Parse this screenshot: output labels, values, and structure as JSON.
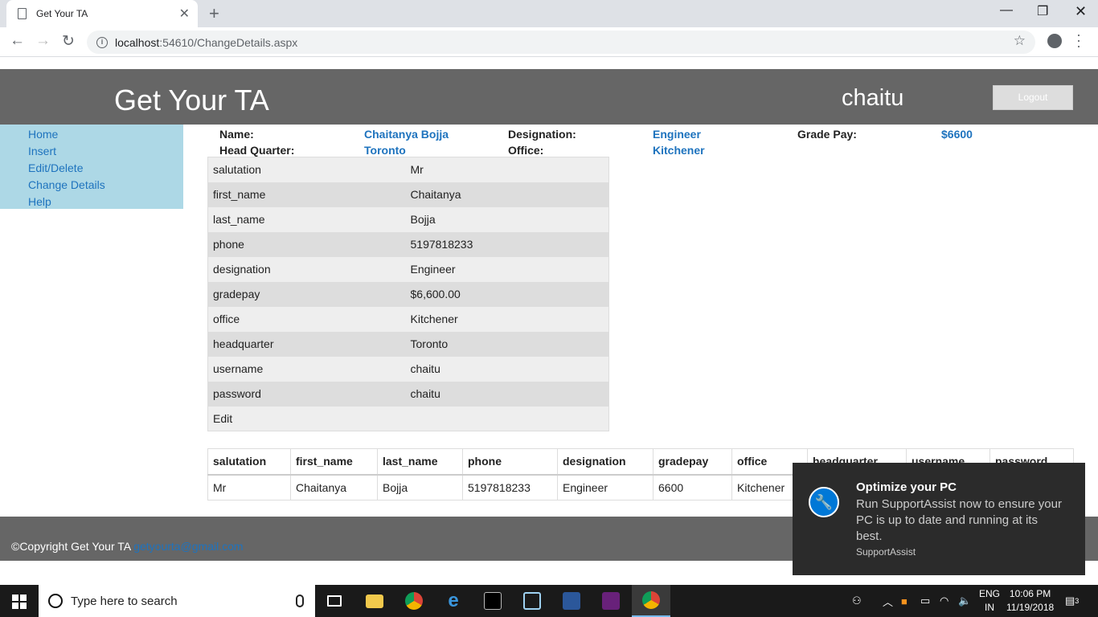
{
  "browser": {
    "tab_title": "Get Your TA",
    "url_host": "localhost",
    "url_path": ":54610/ChangeDetails.aspx"
  },
  "header": {
    "app_title": "Get Your TA",
    "user": "chaitu",
    "logout_label": "Logout"
  },
  "sidebar": {
    "items": [
      {
        "label": "Home"
      },
      {
        "label": "Insert"
      },
      {
        "label": "Edit/Delete"
      },
      {
        "label": "Change Details"
      },
      {
        "label": "Help"
      }
    ]
  },
  "summary": {
    "name_label": "Name:",
    "name_value": "Chaitanya Bojja",
    "designation_label": "Designation:",
    "designation_value": "Engineer",
    "gradepay_label": "Grade Pay:",
    "gradepay_value": "$6600",
    "hq_label": "Head Quarter:",
    "hq_value": "Toronto",
    "office_label": "Office:",
    "office_value": "Kitchener"
  },
  "details": {
    "rows": [
      {
        "key": "salutation",
        "value": "Mr"
      },
      {
        "key": "first_name",
        "value": "Chaitanya"
      },
      {
        "key": "last_name",
        "value": "Bojja"
      },
      {
        "key": "phone",
        "value": "5197818233"
      },
      {
        "key": "designation",
        "value": "Engineer"
      },
      {
        "key": "gradepay",
        "value": "$6,600.00"
      },
      {
        "key": "office",
        "value": "Kitchener"
      },
      {
        "key": "headquarter",
        "value": "Toronto"
      },
      {
        "key": "username",
        "value": "chaitu"
      },
      {
        "key": "password",
        "value": "chaitu"
      }
    ],
    "edit_label": "Edit"
  },
  "grid": {
    "columns": [
      "salutation",
      "first_name",
      "last_name",
      "phone",
      "designation",
      "gradepay",
      "office",
      "headquarter",
      "username",
      "password"
    ],
    "row": [
      "Mr",
      "Chaitanya",
      "Bojja",
      "5197818233",
      "Engineer",
      "6600",
      "Kitchener",
      "",
      "",
      ""
    ]
  },
  "footer": {
    "copyright": "©Copyright Get Your TA",
    "email": "getyourta@gmail.com"
  },
  "toast": {
    "title": "Optimize your PC",
    "body": "Run SupportAssist now to ensure your PC is up to date and running at its best.",
    "source": "SupportAssist"
  },
  "taskbar": {
    "search_placeholder": "Type here to search",
    "lang_line1": "ENG",
    "lang_line2": "IN",
    "time": "10:06 PM",
    "date": "11/19/2018",
    "notification_count": "3"
  }
}
